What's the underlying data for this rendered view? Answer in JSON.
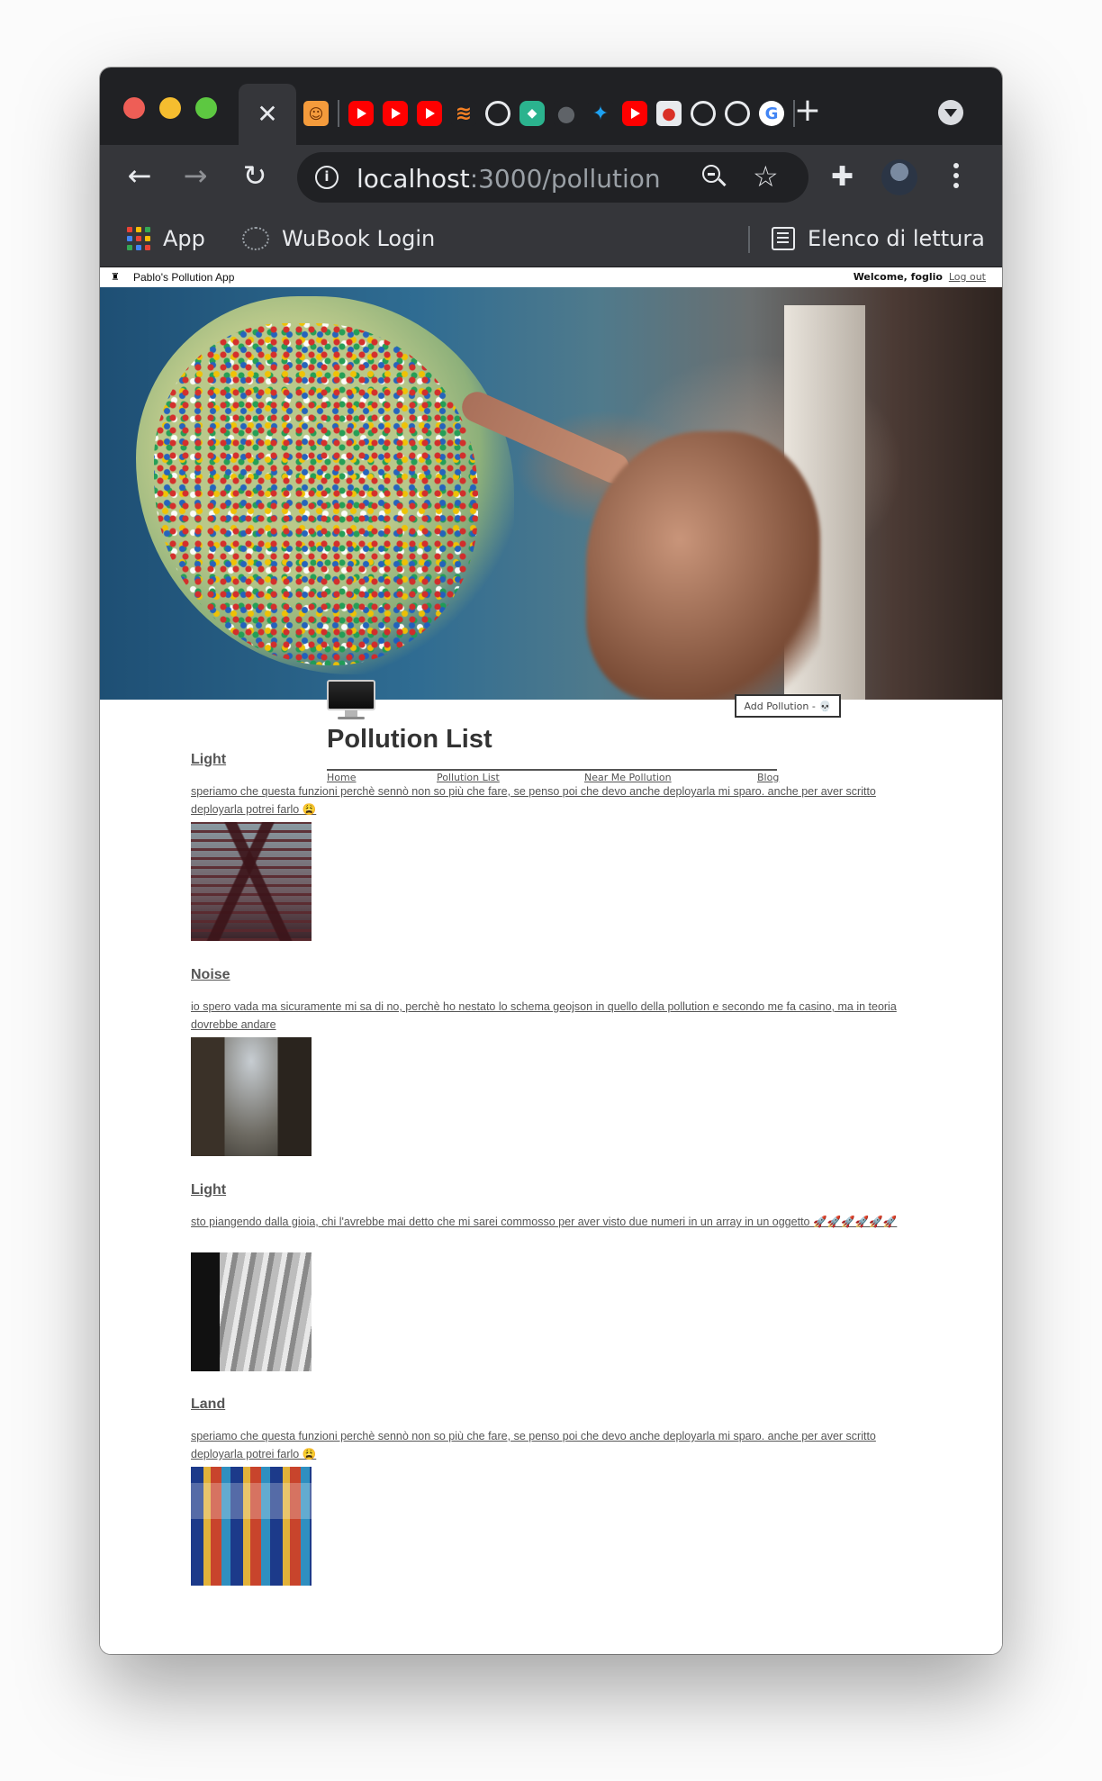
{
  "browser": {
    "active_tab_close": "✕",
    "url_host": "localhost",
    "url_path": ":3000/pollution",
    "new_tab": "+",
    "bookmarks": [
      {
        "label": "App",
        "icon": "apps-grid-icon"
      },
      {
        "label": "WuBook Login",
        "icon": "wubook-icon"
      },
      {
        "label": "Elenco di lettura",
        "icon": "reading-list-icon"
      }
    ],
    "tab_favicons": [
      "mascot",
      "youtube",
      "youtube",
      "youtube",
      "stackoverflow",
      "github",
      "shield",
      "globe",
      "twitter",
      "youtube",
      "person",
      "github",
      "github",
      "google"
    ]
  },
  "app": {
    "name": "Pablo's Pollution App",
    "welcome": "Welcome, foglio",
    "logout": "Log out",
    "title": "Pollution List",
    "nav": [
      "Home",
      "Pollution List",
      "Near Me Pollution",
      "Blog"
    ],
    "add_button": "Add Pollution -",
    "add_button_emoji": "💀"
  },
  "items": [
    {
      "title": "Light",
      "description": "speriamo che questa funzioni perchè sennò non so più che fare, se penso poi che devo anche deployarla mi sparo. anche per aver scritto deployarla potrei farlo 😩",
      "image": "eiffel-tower"
    },
    {
      "title": "Noise",
      "description": "io spero vada ma sicuramente mi sa di no, perchè ho nestato lo schema geojson in quello della pollution e secondo me fa casino, ma in teoria dovrebbe andare",
      "image": "city-street"
    },
    {
      "title": "Light",
      "description": "sto piangendo dalla gioia, chi l'avrebbe mai detto che mi sarei commosso per aver visto due numeri in un array in un oggetto 🚀🚀🚀🚀🚀🚀",
      "image": "subway-train"
    },
    {
      "title": "Land",
      "description": "speriamo che questa funzioni perchè sennò non so più che fare, se penso poi che devo anche deployarla mi sparo. anche per aver scritto deployarla potrei farlo 😩",
      "image": "graffiti-wall"
    }
  ],
  "colors": {
    "chrome_dark": "#202124",
    "chrome_toolbar": "#35363a",
    "text_muted": "#555555"
  }
}
